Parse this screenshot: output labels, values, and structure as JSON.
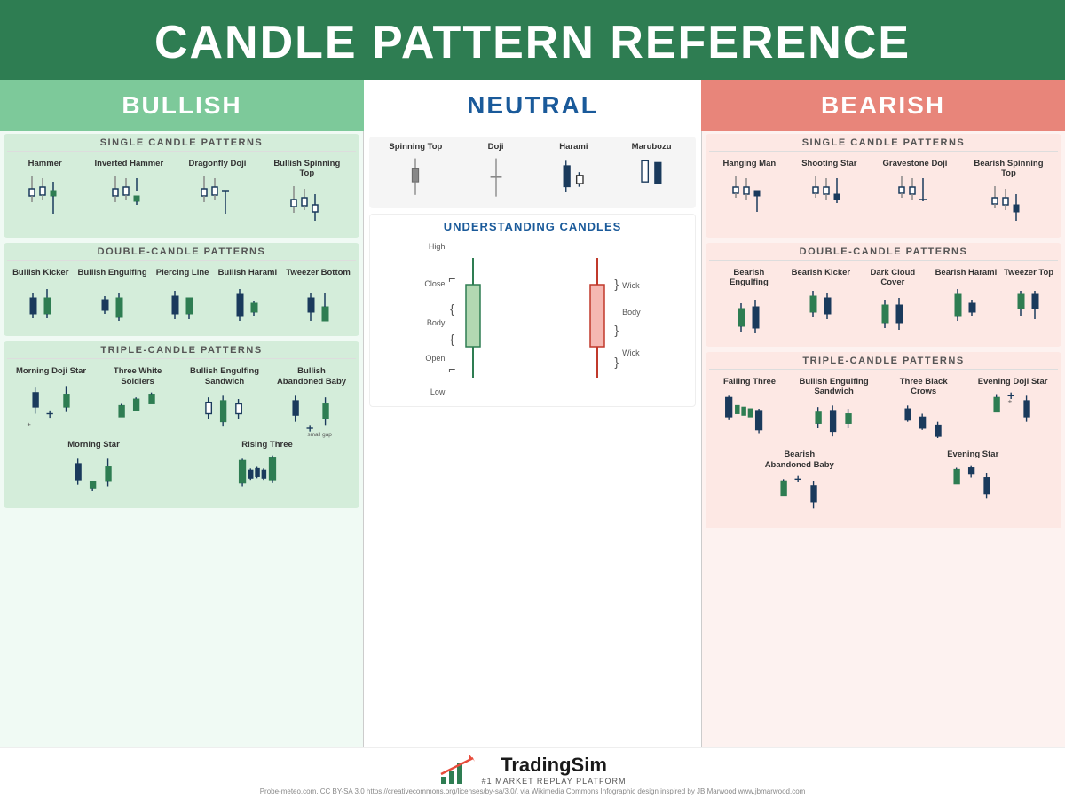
{
  "header": {
    "title": "CANDLE PATTERN REFERENCE"
  },
  "columns": {
    "bullish": {
      "label": "BULLISH"
    },
    "neutral": {
      "label": "NEUTRAL"
    },
    "bearish": {
      "label": "BEARISH"
    }
  },
  "bullish_single": {
    "section_title": "SINGLE CANDLE PATTERNS",
    "patterns": [
      {
        "name": "Hammer"
      },
      {
        "name": "Inverted\nHammer"
      },
      {
        "name": "Dragonfly\nDoji"
      },
      {
        "name": "Bullish\nSpinning Top"
      }
    ]
  },
  "bullish_double": {
    "section_title": "DOUBLE-CANDLE PATTERNS",
    "patterns": [
      {
        "name": "Bullish\nKicker"
      },
      {
        "name": "Bullish\nEngulfing"
      },
      {
        "name": "Piercing\nLine"
      },
      {
        "name": "Bullish\nHarami"
      },
      {
        "name": "Tweezer\nBottom"
      }
    ]
  },
  "bullish_triple": {
    "section_title": "TRIPLE-CANDLE PATTERNS",
    "patterns": [
      {
        "name": "Morning\nDoji Star"
      },
      {
        "name": "Three White\nSoldiers"
      },
      {
        "name": "Bullish\nEngulfing\nSandwich"
      },
      {
        "name": "Bullish\nAbandoned\nBaby"
      },
      {
        "name": "Morning\nStar"
      },
      {
        "name": "Rising\nThree"
      }
    ]
  },
  "neutral_single": {
    "patterns": [
      {
        "name": "Spinning\nTop"
      },
      {
        "name": "Doji"
      },
      {
        "name": "Harami"
      },
      {
        "name": "Marubozu"
      }
    ]
  },
  "bearish_single": {
    "section_title": "SINGLE CANDLE PATTERNS",
    "patterns": [
      {
        "name": "Hanging Man"
      },
      {
        "name": "Shooting Star"
      },
      {
        "name": "Gravestone Doji"
      },
      {
        "name": "Bearish\nSpinning Top"
      }
    ]
  },
  "bearish_double": {
    "section_title": "DOUBLE-CANDLE PATTERNS",
    "patterns": [
      {
        "name": "Bearish\nEngulfing"
      },
      {
        "name": "Bearish\nKicker"
      },
      {
        "name": "Dark Cloud\nCover"
      },
      {
        "name": "Bearish\nHarami"
      },
      {
        "name": "Tweezer\nTop"
      }
    ]
  },
  "bearish_triple": {
    "section_title": "TRIPLE-CANDLE PATTERNS",
    "patterns": [
      {
        "name": "Falling\nThree"
      },
      {
        "name": "Bullish\nEngulfing\nSandwich"
      },
      {
        "name": "Three Black\nCrows"
      },
      {
        "name": "Evening\nDoji Star"
      },
      {
        "name": "Bearish\nAbandoned\nBaby"
      },
      {
        "name": "Evening\nStar"
      }
    ]
  },
  "understanding": {
    "title": "UNDERSTANDING CANDLES",
    "bullish_labels": [
      "High",
      "Close",
      "Body",
      "Open",
      "Low",
      "Wick"
    ],
    "bearish_labels": [
      "High",
      "Open",
      "Body",
      "Close",
      "Low",
      "Wick"
    ]
  },
  "footer": {
    "logo_main": "TradingSim",
    "logo_sub": "#1 MARKET REPLAY PLATFORM",
    "footnote": "Probe-meteo.com, CC BY-SA 3.0 https://creativecommons.org/licenses/by-sa/3.0/, via Wikimedia Commons     Infographic design inspired by JB Marwood www.jbmarwood.com"
  }
}
